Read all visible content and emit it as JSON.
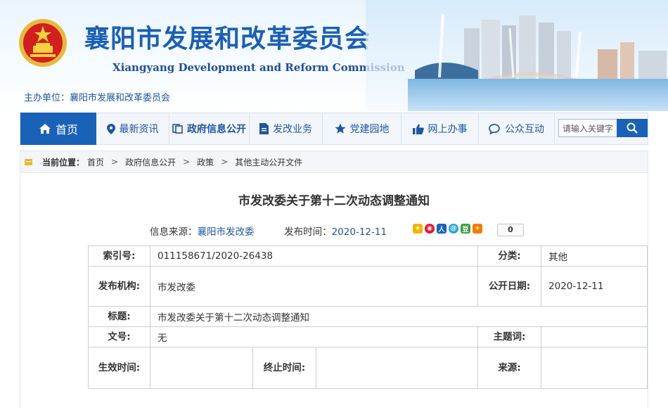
{
  "header": {
    "title_cn": "襄阳市发展和改革委员会",
    "title_en": "Xiangyang Development and Reform Commission",
    "sponsor": "主办单位：襄阳市发展和改革委员会"
  },
  "nav": {
    "home": "首页",
    "items": [
      "最新资讯",
      "政府信息公开",
      "发改业务",
      "党建园地",
      "网上办事",
      "公众互动"
    ],
    "search_placeholder": "请输入关键字"
  },
  "breadcrumb": {
    "label": "当前位置：",
    "items": [
      "首页",
      "政府信息公开",
      "政策",
      "其他主动公开文件"
    ]
  },
  "article": {
    "title": "市发改委关于第十二次动态调整通知",
    "source_label": "信息来源：",
    "source": "襄阳市发改委",
    "date_label": "发布时间：",
    "date": "2020-12-11",
    "share_count": "0"
  },
  "info_table": {
    "index_label": "索引号:",
    "index": "011158671/2020-26438",
    "category_label": "分类:",
    "category": "其他",
    "publisher_label": "发布机构:",
    "publisher": "市发改委",
    "open_date_label": "公开日期:",
    "open_date": "2020-12-11",
    "title_label": "标题:",
    "title": "市发改委关于第十二次动态调整通知",
    "doc_no_label": "文号:",
    "doc_no": "无",
    "subject_label": "主题词:",
    "subject": "",
    "effective_label": "生效时间:",
    "effective": "",
    "end_label": "终止时间:",
    "end": "",
    "source_label": "来源:",
    "source": ""
  },
  "colors": {
    "brand_blue": "#1a62b8",
    "title_blue": "#1a5fb4",
    "emblem_red": "#d21f1f"
  }
}
